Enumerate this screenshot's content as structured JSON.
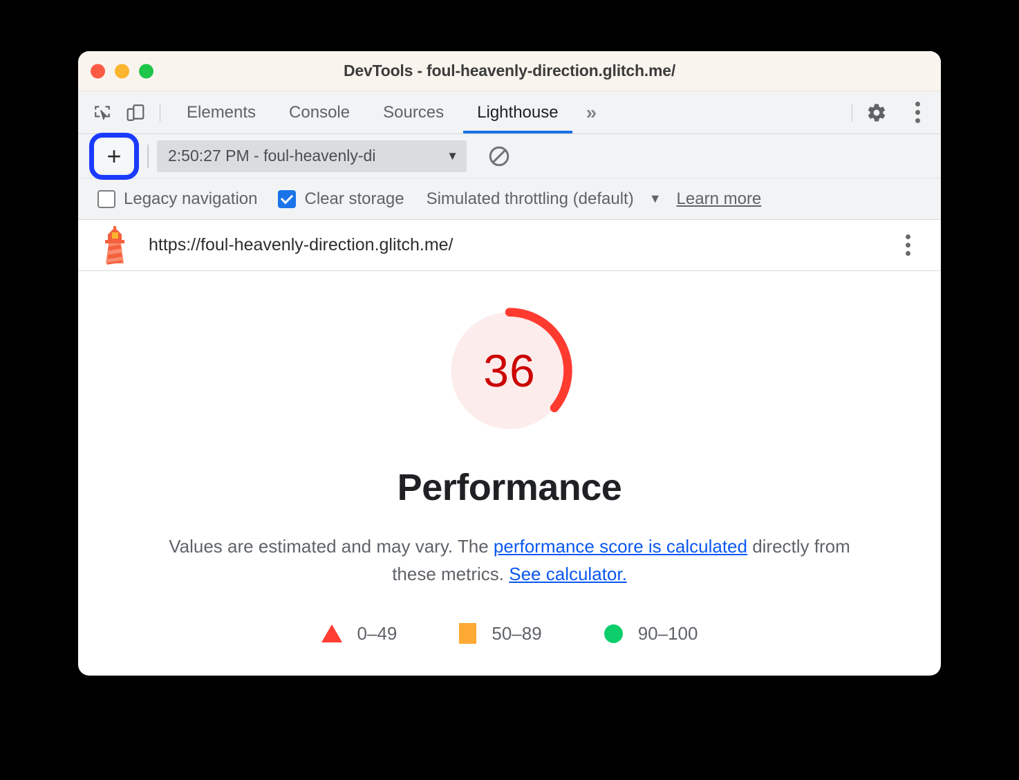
{
  "window": {
    "title": "DevTools - foul-heavenly-direction.glitch.me/",
    "traffic_lights": [
      "close",
      "minimize",
      "zoom"
    ]
  },
  "devtools": {
    "tools": [
      {
        "name": "inspect-element-icon",
        "label": "Inspect element"
      },
      {
        "name": "device-toolbar-icon",
        "label": "Toggle device toolbar"
      }
    ],
    "tabs": [
      {
        "label": "Elements",
        "active": false
      },
      {
        "label": "Console",
        "active": false
      },
      {
        "label": "Sources",
        "active": false
      },
      {
        "label": "Lighthouse",
        "active": true
      }
    ],
    "more_tabs_label": "»",
    "settings_icon": "gear-icon",
    "main_menu_icon": "kebab-menu-icon"
  },
  "lighthouse_toolbar": {
    "add_button_label": "+",
    "run_select_value": "2:50:27 PM - foul-heavenly-di",
    "run_select_caret": "▼",
    "clear_icon": "no-entry-icon"
  },
  "options": {
    "legacy_navigation": {
      "label": "Legacy navigation",
      "checked": false
    },
    "clear_storage": {
      "label": "Clear storage",
      "checked": true
    },
    "throttling": {
      "label": "Simulated throttling (default)",
      "caret": "▼"
    },
    "learn_more": "Learn more"
  },
  "report_header": {
    "icon": "lighthouse-icon",
    "url": "https://foul-heavenly-direction.glitch.me/",
    "menu_icon": "kebab-menu-icon"
  },
  "report": {
    "category": "Performance",
    "score": "36",
    "description_before": "Values are estimated and may vary. The ",
    "link_1": "performance score is calculated",
    "description_middle": " directly from these metrics. ",
    "link_2": "See calculator."
  },
  "legend": [
    {
      "shape": "triangle",
      "range": "0–49",
      "color": "#ff3c32"
    },
    {
      "shape": "square",
      "range": "50–89",
      "color": "#ffaa33"
    },
    {
      "shape": "circle",
      "range": "90–100",
      "color": "#0cce6b"
    }
  ],
  "chart_data": {
    "type": "pie",
    "title": "Performance",
    "score": 36,
    "max": 100,
    "gauge_arc_fraction": 0.36,
    "arc_color": "#ff3b30",
    "track_color": "#fdecec",
    "score_color": "#cc0000",
    "thresholds": [
      {
        "label": "0–49",
        "min": 0,
        "max": 49,
        "color": "#ff3c32"
      },
      {
        "label": "50–89",
        "min": 50,
        "max": 89,
        "color": "#ffaa33"
      },
      {
        "label": "90–100",
        "min": 90,
        "max": 100,
        "color": "#0cce6b"
      }
    ]
  }
}
